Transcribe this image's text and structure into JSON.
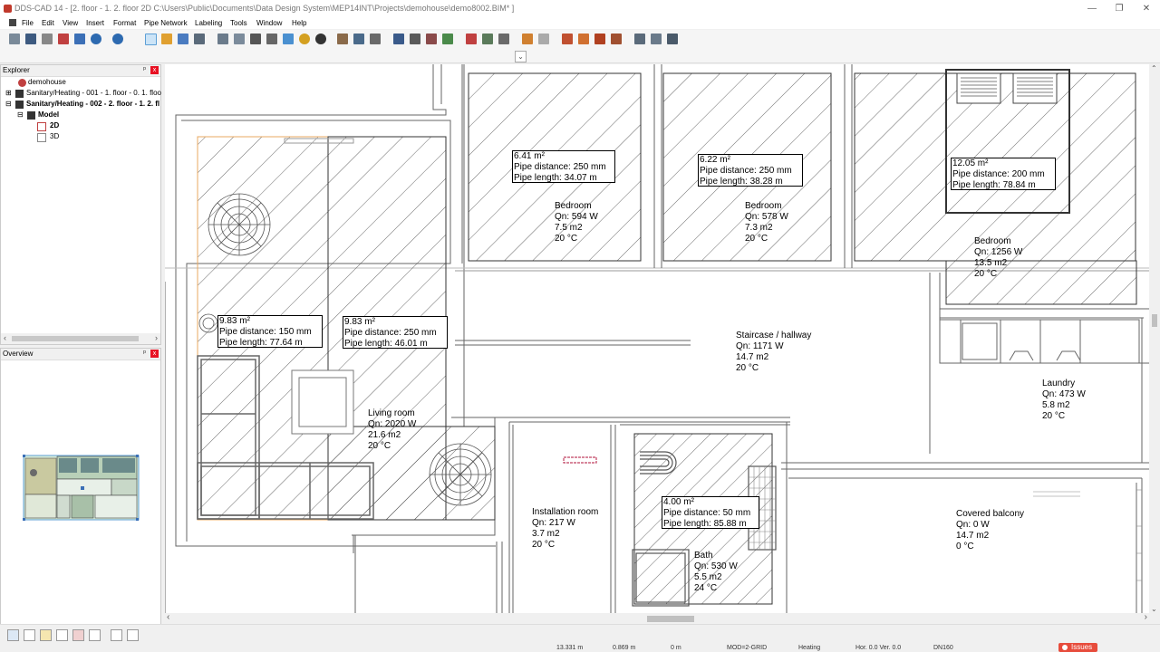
{
  "window": {
    "title": "DDS-CAD 14 - [2. floor - 1. 2. floor 2D  C:\\Users\\Public\\Documents\\Data Design System\\MEP14INT\\Projects\\demohouse\\demo8002.BIM* ]",
    "controls": {
      "minimize": "—",
      "restore": "❐",
      "close": "✕"
    }
  },
  "menu": [
    "File",
    "Edit",
    "View",
    "Insert",
    "Format",
    "Pipe Network",
    "Labeling",
    "Tools",
    "Window",
    "Help"
  ],
  "explorer": {
    "title": "Explorer",
    "pin": "ᵖ",
    "close": "x",
    "items": [
      {
        "label": "demohouse"
      },
      {
        "label": "Sanitary/Heating - 001 - 1. floor - 0. 1. floo"
      },
      {
        "label": "Sanitary/Heating - 002 - 2. floor - 1. 2. fl"
      },
      {
        "label": "Model"
      },
      {
        "label": "2D"
      },
      {
        "label": "3D"
      }
    ]
  },
  "overview": {
    "title": "Overview",
    "pin": "ᵖ",
    "close": "x"
  },
  "zones": [
    {
      "area": "6.41 m²",
      "dist": "Pipe distance: 250 mm",
      "len": "Pipe length: 34.07 m"
    },
    {
      "area": "6.22 m²",
      "dist": "Pipe distance: 250 mm",
      "len": "Pipe length: 38.28 m"
    },
    {
      "area": "12.05 m²",
      "dist": "Pipe distance: 200 mm",
      "len": "Pipe length: 78.84 m"
    },
    {
      "area": "9.83 m²",
      "dist": "Pipe distance: 150 mm",
      "len": "Pipe length: 77.64 m"
    },
    {
      "area": "9.83 m²",
      "dist": "Pipe distance: 250 mm",
      "len": "Pipe length: 46.01 m"
    },
    {
      "area": "4.00 m²",
      "dist": "Pipe distance: 50 mm",
      "len": "Pipe length: 85.88 m"
    }
  ],
  "rooms": [
    {
      "name": "Bedroom",
      "qn": "Qn: 594 W",
      "area": "7.5 m2",
      "temp": "20 °C"
    },
    {
      "name": "Bedroom",
      "qn": "Qn: 578 W",
      "area": "7.3 m2",
      "temp": "20 °C"
    },
    {
      "name": "Bedroom",
      "qn": "Qn: 1256 W",
      "area": "13.5 m2",
      "temp": "20 °C"
    },
    {
      "name": "Staircase / hallway",
      "qn": "Qn: 1171 W",
      "area": "14.7 m2",
      "temp": "20 °C"
    },
    {
      "name": "Laundry",
      "qn": "Qn: 473 W",
      "area": "5.8 m2",
      "temp": "20 °C"
    },
    {
      "name": "Living room",
      "qn": "Qn: 2020 W",
      "area": "21.6 m2",
      "temp": "20 °C"
    },
    {
      "name": "Installation room",
      "qn": "Qn: 217 W",
      "area": "3.7 m2",
      "temp": "20 °C"
    },
    {
      "name": "Bath",
      "qn": "Qn: 530 W",
      "area": "5.5 m2",
      "temp": "24 °C"
    },
    {
      "name": "Covered balcony",
      "qn": "Qn: 0 W",
      "area": "14.7 m2",
      "temp": "0 °C"
    }
  ],
  "status": {
    "x": "13.331 m",
    "y": "0.869 m",
    "z": "0 m",
    "mode": "MOD=2-GRID",
    "discipline": "Heating",
    "hor": "Hor. 0.0 Ver. 0.0",
    "dn": "DN160",
    "issues": "Issues"
  },
  "colors": {
    "accent": "#5c9fd6",
    "issues": "#e74c3c",
    "close": "#e81123",
    "selection_orange": "#f0a040"
  }
}
